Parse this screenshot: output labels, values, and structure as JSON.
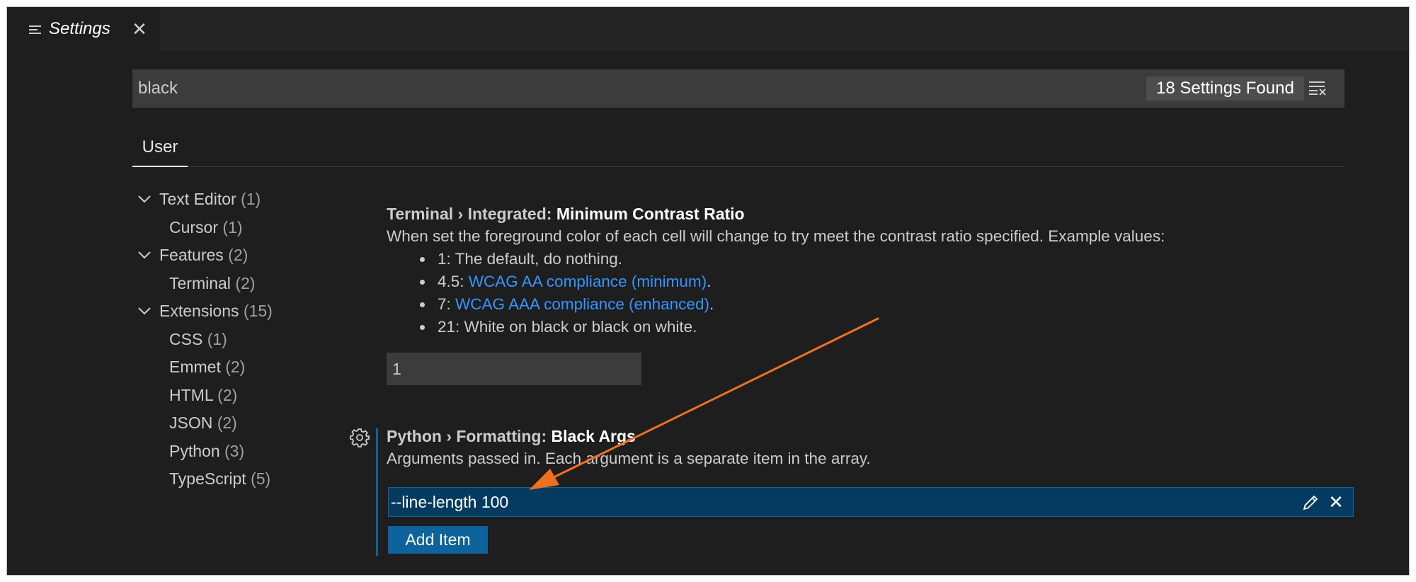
{
  "tab": {
    "title": "Settings",
    "close_icon": "close-icon",
    "icon": "list-icon"
  },
  "search": {
    "value": "black",
    "results": "18 Settings Found",
    "clear_icon": "clear-filter-icon"
  },
  "scope_tabs": [
    {
      "label": "User",
      "active": true
    }
  ],
  "toc": [
    {
      "label": "Text Editor",
      "count": "(1)",
      "level": 0,
      "expanded": true
    },
    {
      "label": "Cursor",
      "count": "(1)",
      "level": 1
    },
    {
      "label": "Features",
      "count": "(2)",
      "level": 0,
      "expanded": true
    },
    {
      "label": "Terminal",
      "count": "(2)",
      "level": 1
    },
    {
      "label": "Extensions",
      "count": "(15)",
      "level": 0,
      "expanded": true
    },
    {
      "label": "CSS",
      "count": "(1)",
      "level": 1
    },
    {
      "label": "Emmet",
      "count": "(2)",
      "level": 1
    },
    {
      "label": "HTML",
      "count": "(2)",
      "level": 1
    },
    {
      "label": "JSON",
      "count": "(2)",
      "level": 1
    },
    {
      "label": "Python",
      "count": "(3)",
      "level": 1
    },
    {
      "label": "TypeScript",
      "count": "(5)",
      "level": 1
    }
  ],
  "setting1": {
    "category": "Terminal › Integrated: ",
    "name": "Minimum Contrast Ratio",
    "description": "When set the foreground color of each cell will change to try meet the contrast ratio specified. Example values:",
    "bullets": [
      {
        "prefix": "1: The default, do nothing.",
        "link": "",
        "suffix": ""
      },
      {
        "prefix": "4.5: ",
        "link": "WCAG AA compliance (minimum)",
        "suffix": "."
      },
      {
        "prefix": "7: ",
        "link": "WCAG AAA compliance (enhanced)",
        "suffix": "."
      },
      {
        "prefix": "21: White on black or black on white.",
        "link": "",
        "suffix": ""
      }
    ],
    "value": "1"
  },
  "setting2": {
    "category": "Python › Formatting: ",
    "name": "Black Args",
    "description": "Arguments passed in. Each argument is a separate item in the array.",
    "items": [
      "--line-length 100"
    ],
    "add_label": "Add Item",
    "gear_icon": "gear-icon",
    "edit_icon": "pencil-icon",
    "remove_icon": "close-icon"
  },
  "colors": {
    "background": "#1e1e1e",
    "accent": "#0e639c",
    "link": "#3794ff",
    "annotation_arrow": "#f07021"
  }
}
